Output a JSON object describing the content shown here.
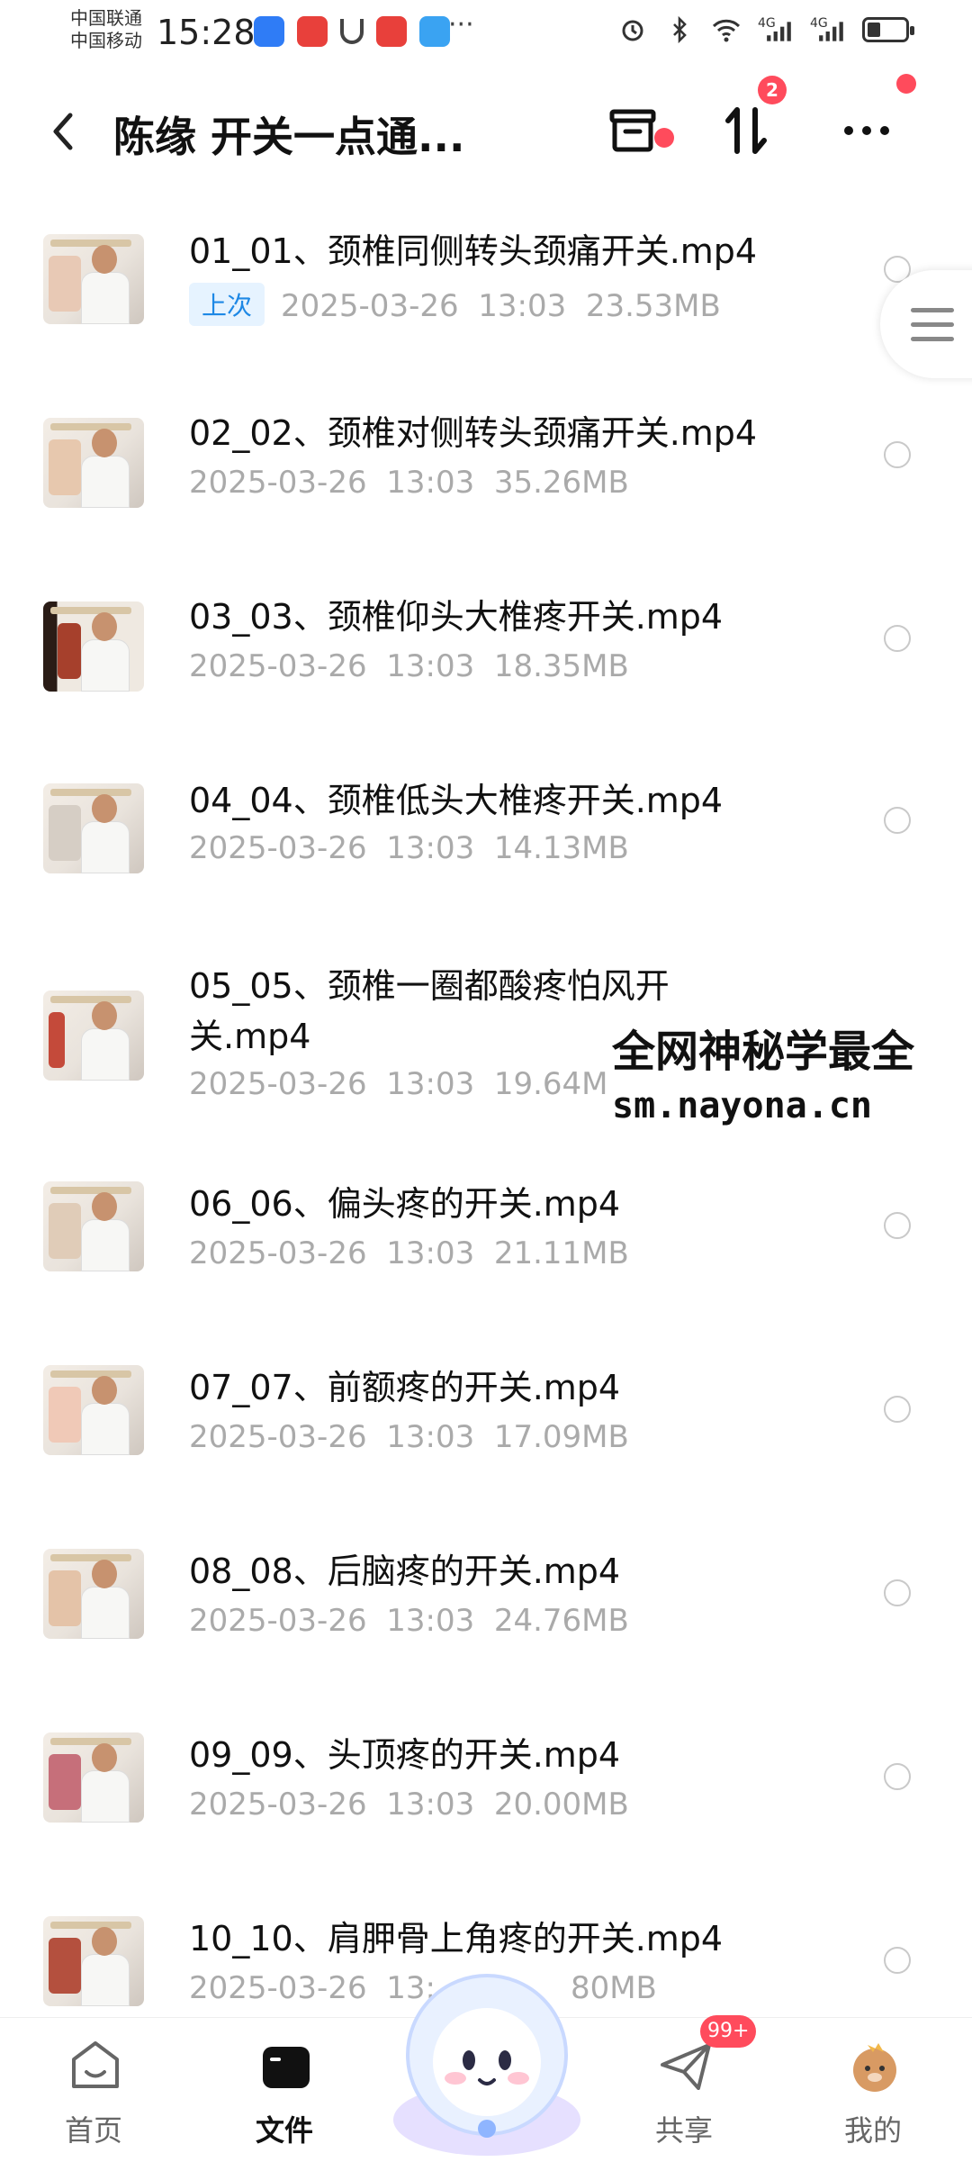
{
  "status_bar": {
    "carrier1": "中国联通",
    "carrier2": "中国移动",
    "time": "15:28",
    "more": "···",
    "signal1": "4G",
    "signal2": "4G"
  },
  "header": {
    "title": "陈缘 开关一点通...",
    "transfer_badge": "2"
  },
  "files": [
    {
      "name": "01_01、颈椎同侧转头颈痛开关.mp4",
      "tag": "上次",
      "date": "2025-03-26",
      "time": "13:03",
      "size": "23.53MB"
    },
    {
      "name": "02_02、颈椎对侧转头颈痛开关.mp4",
      "tag": "",
      "date": "2025-03-26",
      "time": "13:03",
      "size": "35.26MB"
    },
    {
      "name": "03_03、颈椎仰头大椎疼开关.mp4",
      "tag": "",
      "date": "2025-03-26",
      "time": "13:03",
      "size": "18.35MB"
    },
    {
      "name": "04_04、颈椎低头大椎疼开关.mp4",
      "tag": "",
      "date": "2025-03-26",
      "time": "13:03",
      "size": "14.13MB"
    },
    {
      "name_line1": "05_05、颈椎一圈都酸疼怕风开",
      "name_line2": "关.mp4",
      "tag": "",
      "date": "2025-03-26",
      "time": "13:03",
      "size": "19.64M"
    },
    {
      "name": "06_06、偏头疼的开关.mp4",
      "tag": "",
      "date": "2025-03-26",
      "time": "13:03",
      "size": "21.11MB"
    },
    {
      "name": "07_07、前额疼的开关.mp4",
      "tag": "",
      "date": "2025-03-26",
      "time": "13:03",
      "size": "17.09MB"
    },
    {
      "name": "08_08、后脑疼的开关.mp4",
      "tag": "",
      "date": "2025-03-26",
      "time": "13:03",
      "size": "24.76MB"
    },
    {
      "name": "09_09、头顶疼的开关.mp4",
      "tag": "",
      "date": "2025-03-26",
      "time": "13:03",
      "size": "20.00MB"
    },
    {
      "name": "10_10、肩胛骨上角疼的开关.mp4",
      "tag": "",
      "date": "2025-03-26",
      "time": "13:",
      "size": "80MB"
    }
  ],
  "watermark": {
    "line1": "全网神秘学最全",
    "line2": "sm.nayona.cn"
  },
  "tabbar": {
    "home": "首页",
    "files": "文件",
    "share": "共享",
    "mine": "我的",
    "share_badge": "99+"
  },
  "colors": {
    "accent_blue": "#1e88e5",
    "badge_red": "#ff4b5c",
    "meta_gray": "#aaaaaa"
  }
}
